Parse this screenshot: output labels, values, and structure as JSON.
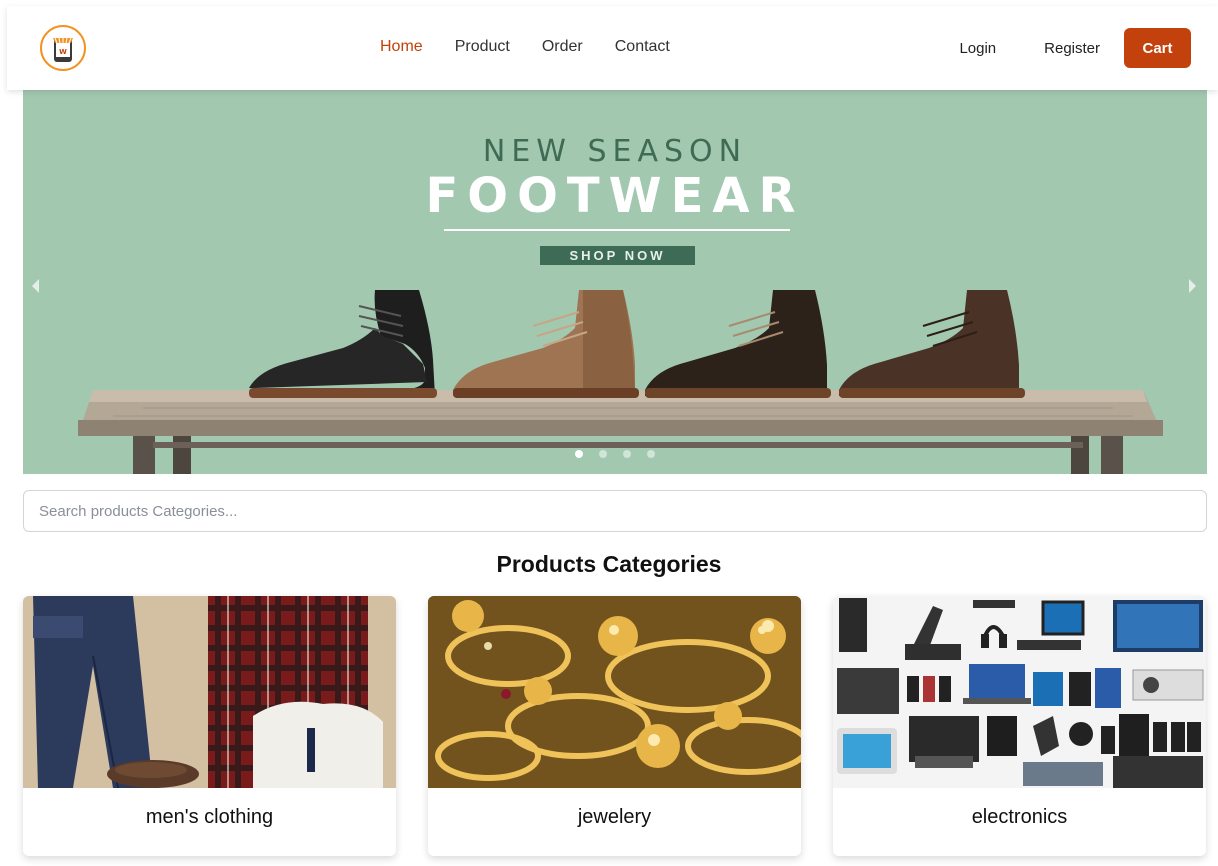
{
  "nav": {
    "logo_icon": "shop-icon",
    "links": [
      {
        "label": "Home",
        "active": true
      },
      {
        "label": "Product",
        "active": false
      },
      {
        "label": "Order",
        "active": false
      },
      {
        "label": "Contact",
        "active": false
      }
    ],
    "login_label": "Login",
    "register_label": "Register",
    "cart_label": "Cart"
  },
  "hero": {
    "subtitle": "NEW SEASON",
    "title": "FOOTWEAR",
    "button_label": "SHOP NOW",
    "slide_count": 4,
    "active_slide": 1,
    "background_color": "#a2c8b0"
  },
  "search": {
    "placeholder": "Search products Categories...",
    "value": ""
  },
  "categories": {
    "title": "Products Categories",
    "items": [
      {
        "name": "men's clothing"
      },
      {
        "name": "jewelery"
      },
      {
        "name": "electronics"
      }
    ]
  },
  "colors": {
    "accent": "#c2410c",
    "logo_ring": "#f29222"
  }
}
